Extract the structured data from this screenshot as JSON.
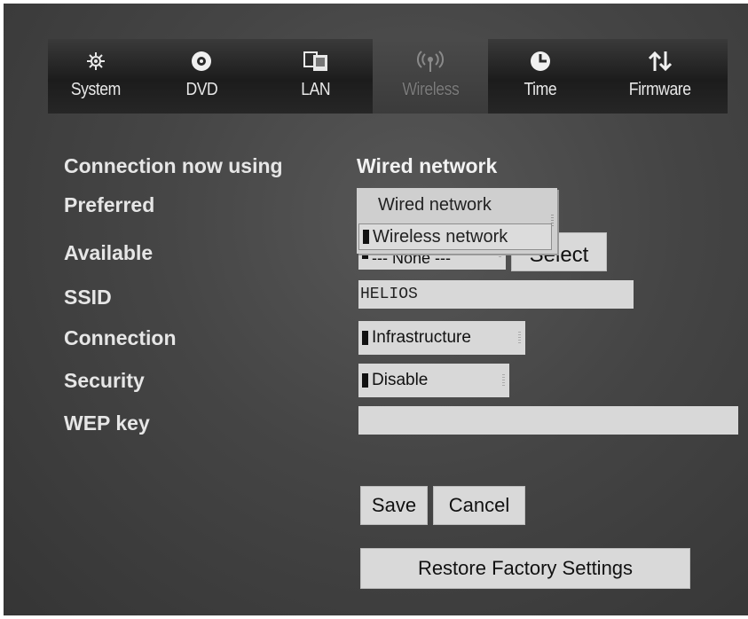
{
  "tabs": [
    {
      "label": "System",
      "icon": "gear-icon"
    },
    {
      "label": "DVD",
      "icon": "disc-icon"
    },
    {
      "label": "LAN",
      "icon": "lan-icon"
    },
    {
      "label": "Wireless",
      "icon": "wireless-icon",
      "active": true
    },
    {
      "label": "Time",
      "icon": "clock-icon"
    },
    {
      "label": "Firmware",
      "icon": "firmware-update-icon"
    }
  ],
  "form": {
    "connection_label": "Connection now using",
    "connection_value": "Wired network",
    "preferred_label": "Preferred",
    "available_label": "Available",
    "ssid_label": "SSID",
    "connection_mode_label": "Connection",
    "security_label": "Security",
    "wep_label": "WEP key"
  },
  "preferred_dropdown": {
    "options": [
      "Wired network",
      "Wireless network"
    ],
    "highlighted": "Wireless network"
  },
  "available_select": {
    "value": "--- None ---",
    "button": "Select"
  },
  "ssid_value": "HELIOS",
  "connection_mode_value": "Infrastructure",
  "security_value": "Disable",
  "wep_value": "",
  "buttons": {
    "save": "Save",
    "cancel": "Cancel",
    "restore": "Restore Factory Settings"
  },
  "colors": {
    "background": "#454545",
    "control": "#d8d8d8",
    "text": "#e6e6e6"
  }
}
